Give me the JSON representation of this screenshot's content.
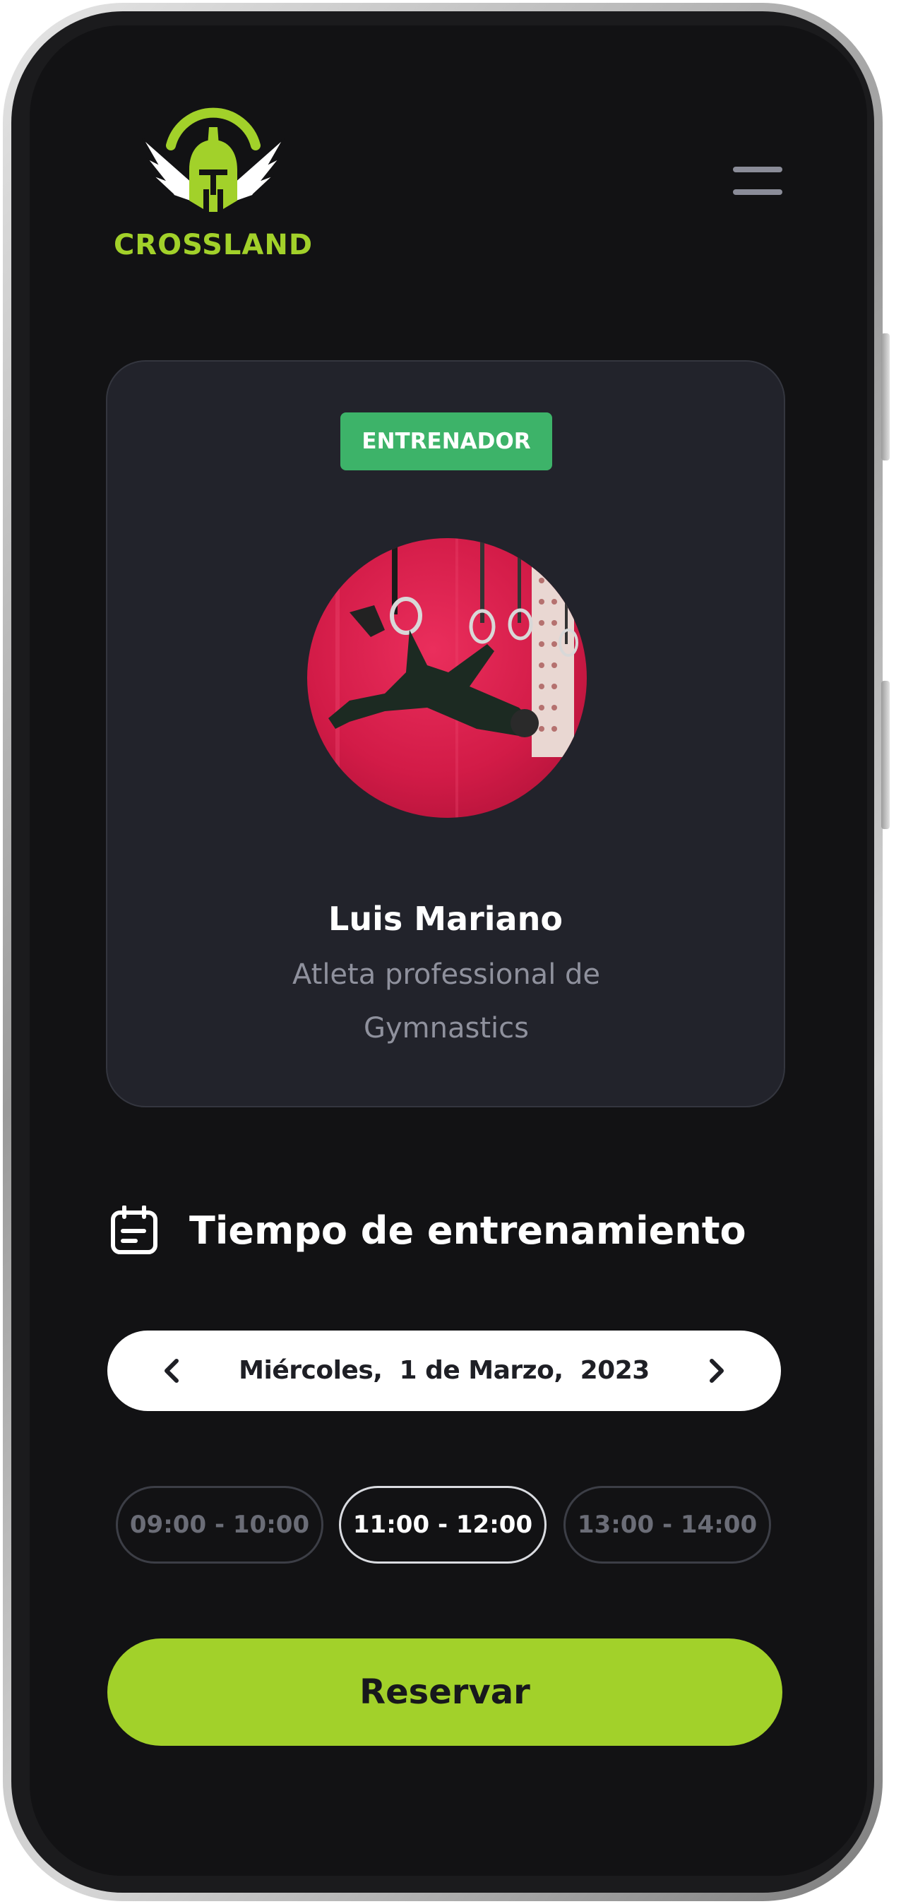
{
  "brand": {
    "name": "CROSSLAND",
    "accent_color": "#a2d12a"
  },
  "header": {
    "menu_icon": "hamburger-menu-icon"
  },
  "trainer": {
    "badge": "ENTRENADOR",
    "badge_color": "#3db369",
    "name": "Luis Mariano",
    "description": "Atleta professional de Gymnastics",
    "photo": "gymnast-on-rings-photo"
  },
  "schedule": {
    "title": "Tiempo de entrenamiento",
    "title_icon": "calendar-icon",
    "date": {
      "label": "Miércoles,  1 de Marzo,  2023",
      "prev_icon": "chevron-left-icon",
      "next_icon": "chevron-right-icon"
    },
    "slots": [
      {
        "label": "09:00 - 10:00",
        "selected": false
      },
      {
        "label": "11:00 - 12:00",
        "selected": true
      },
      {
        "label": "13:00 - 14:00",
        "selected": false
      }
    ]
  },
  "actions": {
    "reserve_label": "Reservar"
  }
}
